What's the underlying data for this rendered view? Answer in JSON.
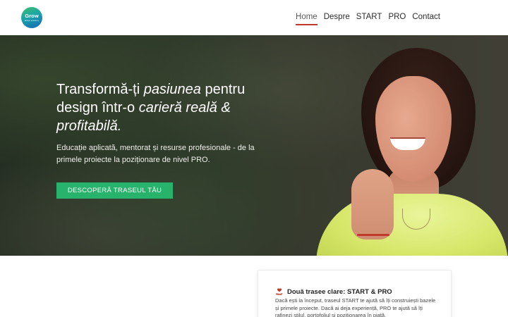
{
  "header": {
    "logo": {
      "word": "Grow",
      "sub": "design academy"
    },
    "nav": [
      {
        "label": "Home",
        "active": true
      },
      {
        "label": "Despre",
        "active": false
      },
      {
        "label": "START",
        "active": false
      },
      {
        "label": "PRO",
        "active": false
      },
      {
        "label": "Contact",
        "active": false
      }
    ]
  },
  "hero": {
    "title": {
      "p1": "Transformă-ți ",
      "p2": "pasiunea",
      "p3": " pentru design într-o ",
      "p4": "carieră reală & profitabilă.",
      "p5": ""
    },
    "subtitle": "Educație aplicată, mentorat și resurse profesionale - de la primele proiecte la poziționare de nivel PRO.",
    "cta_label": "DESCOPERĂ TRASEUL TĂU"
  },
  "card": {
    "title": "Două trasee clare: START & PRO",
    "text": "Dacă ești la început, traseul START te ajută să îți construiești bazele și primele proiecte. Dacă ai deja experiență, PRO te ajută să îți rafinezi stilul, portofoliul și poziționarea în piață.",
    "icon": "hand-heart-icon"
  },
  "colors": {
    "accent": "#27b36c",
    "nav_underline": "#c0392b",
    "icon": "#c0392b"
  }
}
